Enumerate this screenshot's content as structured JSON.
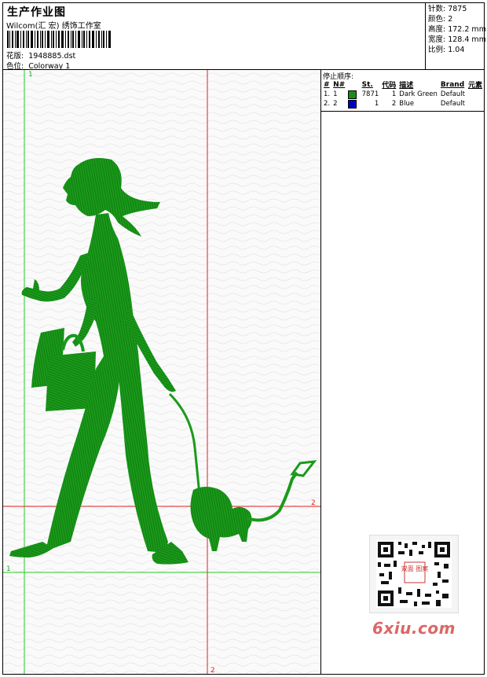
{
  "header": {
    "title": "生产作业图",
    "studio": "Wilcom(汇 宏) 绣饰工作室",
    "design_label": "花版:",
    "design_value": "1948885.dst",
    "colorway_label": "色位:",
    "colorway_value": "Colorway 1"
  },
  "stats": {
    "stitches": "针数: 7875",
    "colors": "颜色: 2",
    "height": "高度: 172.2 mm",
    "width": "宽度: 128.4 mm",
    "ratio": "比例: 1.04"
  },
  "stop_panel": {
    "title": "停止顺序:",
    "headers": [
      "#",
      "N#",
      "St.",
      "代码",
      "描述",
      "Brand",
      "元素"
    ],
    "rows": [
      {
        "num": "1.",
        "n": "1",
        "color": "#1a8c1a",
        "st": "7871",
        "code": "1",
        "desc": "Dark Green",
        "brand": "Default",
        "elem": ""
      },
      {
        "num": "2.",
        "n": "2",
        "color": "#0000cc",
        "st": "1",
        "code": "2",
        "desc": "Blue",
        "brand": "Default",
        "elem": ""
      }
    ]
  },
  "guides": {
    "v1": "1",
    "h1": "1",
    "v2": "2",
    "h2": "2"
  },
  "watermark": {
    "site": "6xiu.com",
    "qr_badge": "双面 图案"
  },
  "colors": {
    "embroidery": "#1a9a1a",
    "guide_green": "#22cc22",
    "guide_red": "#dd2222"
  }
}
